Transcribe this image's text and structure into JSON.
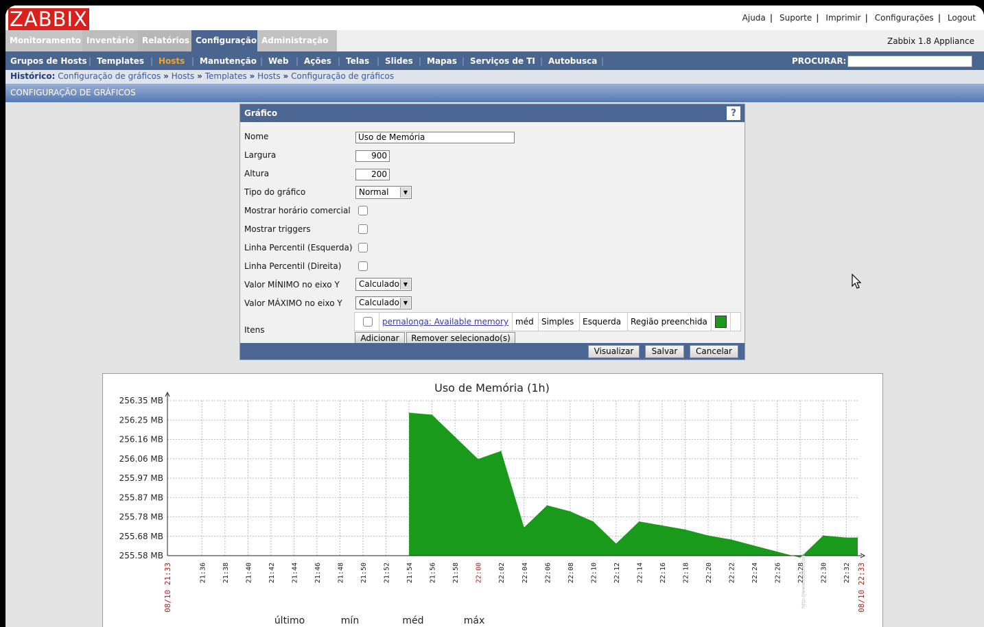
{
  "logo": "ZABBIX",
  "top_links": [
    "Ajuda",
    "Suporte",
    "Imprimir",
    "Configurações",
    "Logout"
  ],
  "main_menu": [
    "Monitoramento",
    "Inventário",
    "Relatórios",
    "Configuração",
    "Administração"
  ],
  "main_menu_active": "Configuração",
  "appliance": "Zabbix 1.8 Appliance",
  "sub_menu": [
    "Grupos de Hosts",
    "Templates",
    "Hosts",
    "Manutenção",
    "Web",
    "Ações",
    "Telas",
    "Slides",
    "Mapas",
    "Serviços de TI",
    "Autobusca"
  ],
  "sub_menu_active": "Hosts",
  "search_label": "PROCURAR:",
  "history": {
    "label": "Histórico:",
    "items": [
      "Configuração de gráficos",
      "Hosts",
      "Templates",
      "Hosts",
      "Configuração de gráficos"
    ],
    "separator": "»"
  },
  "page_title": "CONFIGURAÇÃO DE GRÁFICOS",
  "form": {
    "header": "Gráfico",
    "help": "?",
    "fields": {
      "nome_label": "Nome",
      "nome_value": "Uso de Memória",
      "largura_label": "Largura",
      "largura_value": "900",
      "altura_label": "Altura",
      "altura_value": "200",
      "tipo_label": "Tipo do gráfico",
      "tipo_value": "Normal",
      "horario_label": "Mostrar horário comercial",
      "triggers_label": "Mostrar triggers",
      "perc_esq_label": "Linha Percentil (Esquerda)",
      "perc_dir_label": "Linha Percentil (Direita)",
      "ymin_label": "Valor MÍNIMO no eixo Y",
      "ymin_value": "Calculado",
      "ymax_label": "Valor MÁXIMO no eixo Y",
      "ymax_value": "Calculado",
      "itens_label": "Itens"
    },
    "item": {
      "name": "pernalonga: Available memory",
      "function": "méd",
      "draw": "Simples",
      "axis": "Esquerda",
      "style": "Região preenchida",
      "color": "#1a9a1a"
    },
    "buttons": {
      "add": "Adicionar",
      "remove": "Remover selecionado(s)",
      "preview": "Visualizar",
      "save": "Salvar",
      "cancel": "Cancelar"
    }
  },
  "chart_data": {
    "type": "area",
    "title": "Uso de Memória  (1h)",
    "y_ticks": [
      "256.35 MB",
      "256.25 MB",
      "256.16 MB",
      "256.06 MB",
      "255.97 MB",
      "255.87 MB",
      "255.78 MB",
      "255.68 MB",
      "255.58 MB"
    ],
    "ylim": [
      255.58,
      256.35
    ],
    "x_ticks": [
      "21:36",
      "21:38",
      "21:40",
      "21:42",
      "21:44",
      "21:46",
      "21:48",
      "21:50",
      "21:52",
      "21:54",
      "21:56",
      "21:58",
      "22:00",
      "22:02",
      "22:04",
      "22:06",
      "22:08",
      "22:10",
      "22:12",
      "22:14",
      "22:16",
      "22:18",
      "22:20",
      "22:22",
      "22:24",
      "22:26",
      "22:28",
      "22:30",
      "22:32"
    ],
    "x_start_label": "08/10 21:33",
    "x_end_label": "08/10 22:33",
    "x_range_minutes": [
      0,
      60
    ],
    "series": [
      {
        "color": "#1a9a1a",
        "x_minutes": [
          21,
          23,
          25,
          27,
          29,
          31,
          33,
          35,
          37,
          39,
          41,
          43,
          45,
          47,
          49,
          51,
          53,
          55,
          57,
          59,
          60
        ],
        "values": [
          256.29,
          256.28,
          256.17,
          256.06,
          256.1,
          255.72,
          255.83,
          255.8,
          255.75,
          255.64,
          255.75,
          255.73,
          255.71,
          255.68,
          255.66,
          255.63,
          255.6,
          255.57,
          255.68,
          255.67,
          255.67
        ]
      }
    ],
    "legend_headers": [
      "último",
      "mín",
      "méd",
      "máx"
    ],
    "watermark": "http://www.zabbix.com"
  }
}
